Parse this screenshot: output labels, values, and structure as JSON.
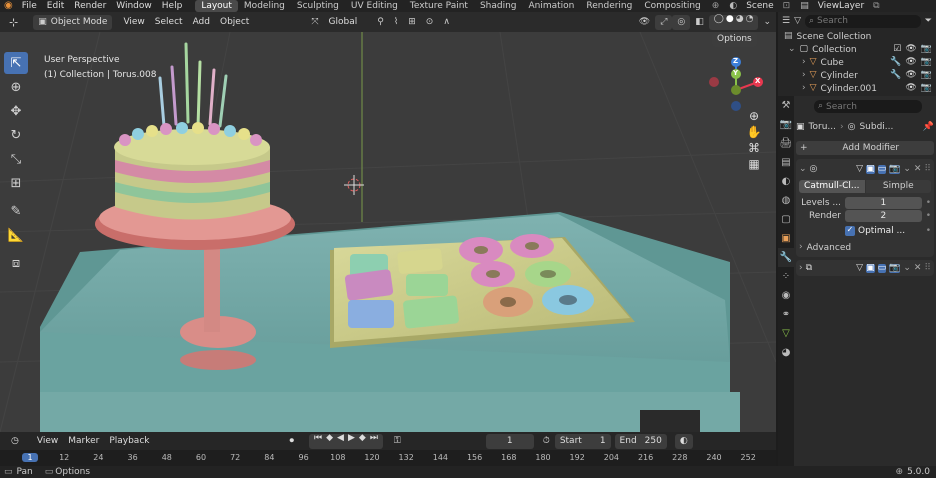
{
  "topbar": {
    "menus": [
      "File",
      "Edit",
      "Render",
      "Window",
      "Help"
    ],
    "workspaces": [
      {
        "label": "Layout",
        "active": true
      },
      {
        "label": "Modeling",
        "active": false
      },
      {
        "label": "Sculpting",
        "active": false
      },
      {
        "label": "UV Editing",
        "active": false
      },
      {
        "label": "Texture Paint",
        "active": false
      },
      {
        "label": "Shading",
        "active": false
      },
      {
        "label": "Animation",
        "active": false
      },
      {
        "label": "Rendering",
        "active": false
      },
      {
        "label": "Compositing",
        "active": false
      }
    ],
    "scene": "Scene",
    "view_layer": "ViewLayer"
  },
  "viewport_header": {
    "mode": "Object Mode",
    "menus": [
      "View",
      "Select",
      "Add",
      "Object"
    ],
    "orientation": "Global",
    "options": "Options"
  },
  "viewport": {
    "perspective": "User Perspective",
    "collection_info": "(1) Collection | Torus.008",
    "gizmo": {
      "x": "X",
      "y": "Y",
      "z": "Z"
    }
  },
  "outliner": {
    "search_placeholder": "Search",
    "root": "Scene Collection",
    "collection": "Collection",
    "items": [
      "Cube",
      "Cylinder",
      "Cylinder.001"
    ]
  },
  "properties": {
    "search_placeholder": "Search",
    "breadcrumb_object": "Toru...",
    "breadcrumb_modifier": "Subdi...",
    "add_modifier": "Add Modifier",
    "subdiv_types": [
      "Catmull-Cl...",
      "Simple"
    ],
    "levels_label": "Levels ...",
    "levels_value": "1",
    "render_label": "Render",
    "render_value": "2",
    "optimal_label": "Optimal ...",
    "advanced_label": "Advanced"
  },
  "timeline": {
    "menus": [
      "View",
      "Marker",
      "Playback"
    ],
    "current_frame": "1",
    "start_label": "Start",
    "start_value": "1",
    "end_label": "End",
    "end_value": "250",
    "ticks": [
      "1",
      "12",
      "24",
      "36",
      "48",
      "60",
      "72",
      "84",
      "96",
      "108",
      "120",
      "132",
      "144",
      "156",
      "168",
      "180",
      "192",
      "204",
      "216",
      "228",
      "240",
      "252"
    ]
  },
  "statusbar": {
    "pan": "Pan",
    "options": "Options",
    "version": "5.0.0"
  },
  "colors": {
    "accent": "#4772b3",
    "active_tab": "#5ab0e8",
    "viewport_bg": "#3c3c3c",
    "axis_x": "#e8384f",
    "axis_y": "#8ac24a",
    "axis_z": "#3c7fd8"
  }
}
